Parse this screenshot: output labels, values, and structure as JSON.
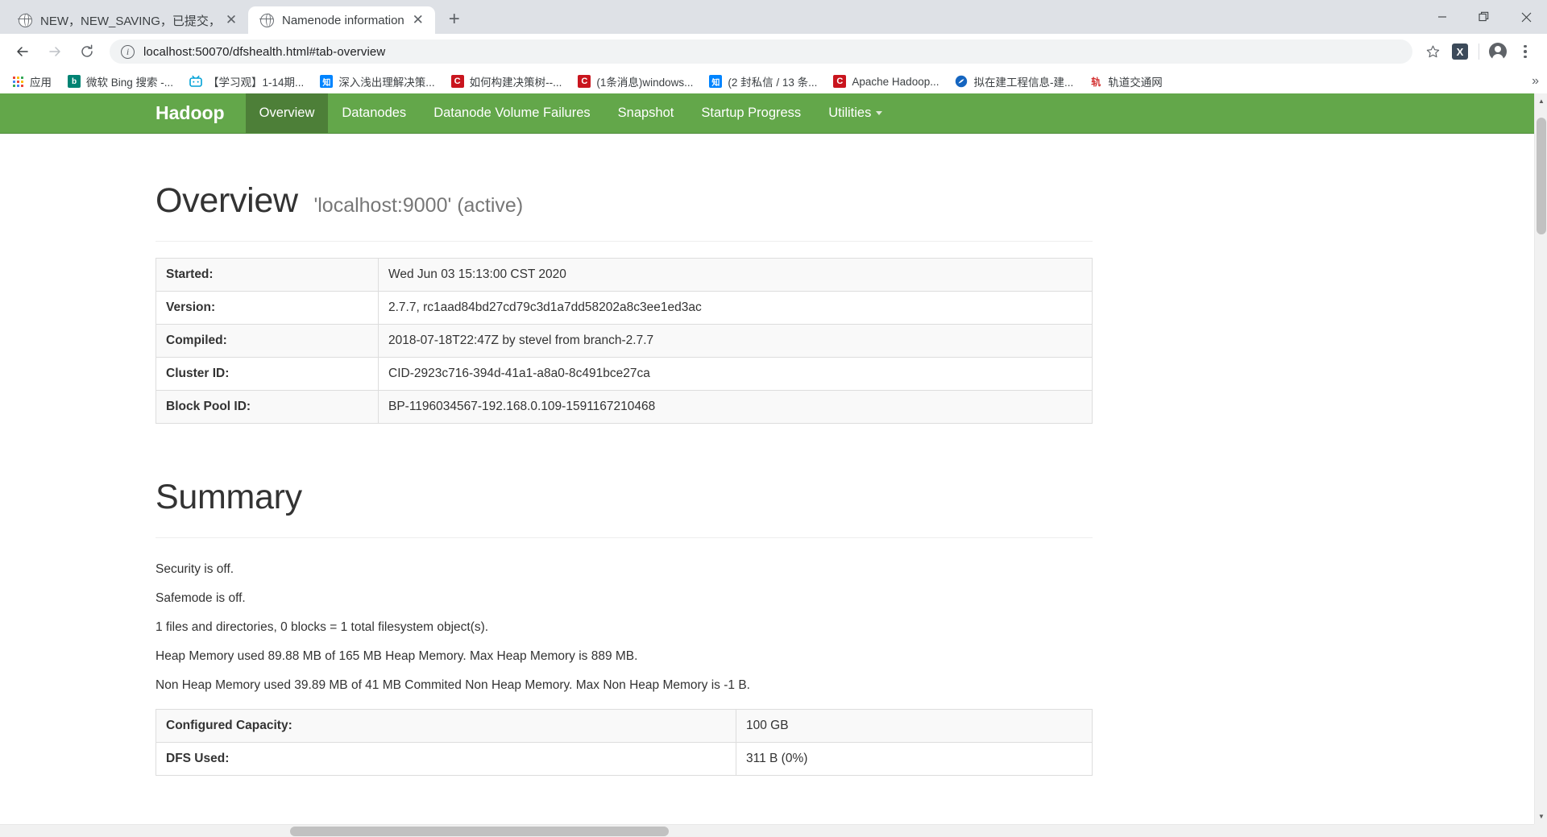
{
  "browser": {
    "tabs": [
      {
        "title": "NEW，NEW_SAVING，已提交，",
        "favicon": "globe-icon",
        "active": false
      },
      {
        "title": "Namenode information",
        "favicon": "globe-icon",
        "active": true
      }
    ],
    "newtab_label": "+",
    "window_controls": {
      "minimize": "minimize-icon",
      "maximize": "maximize-icon",
      "close": "close-icon"
    },
    "toolbar": {
      "back": "back-arrow-icon",
      "forward": "forward-arrow-icon",
      "reload": "reload-icon",
      "site_info": "info-icon",
      "url": "localhost:50070/dfshealth.html#tab-overview",
      "url_host": "localhost:50070",
      "url_path": "/dfshealth.html#tab-overview",
      "bookmark_star": "star-icon",
      "extension": "X",
      "profile": "avatar-icon",
      "menu": "kebab-menu-icon"
    },
    "bookmarks": [
      {
        "label": "应用",
        "icon": "apps-grid-icon",
        "color": "#5f6368"
      },
      {
        "label": "微软 Bing 搜索 -...",
        "icon": "bing-icon",
        "color": "#008373"
      },
      {
        "label": "【学习观】1-14期...",
        "icon": "bilibili-icon",
        "color": "#00A1D6"
      },
      {
        "label": "深入浅出理解决策...",
        "icon": "zhihu-icon",
        "color": "#0084FF"
      },
      {
        "label": "如何构建决策树--...",
        "icon": "csdn-icon",
        "color": "#C9151E"
      },
      {
        "label": "(1条消息)windows...",
        "icon": "csdn-icon",
        "color": "#C9151E"
      },
      {
        "label": "(2 封私信 / 13 条...",
        "icon": "zhihu-icon",
        "color": "#0084FF"
      },
      {
        "label": "Apache Hadoop...",
        "icon": "csdn-icon",
        "color": "#C9151E"
      },
      {
        "label": "拟在建工程信息-建...",
        "icon": "site-icon",
        "color": "#1565C0"
      },
      {
        "label": "轨道交通网",
        "icon": "rail-icon",
        "color": "#D32F2F"
      }
    ],
    "bookmarks_overflow": "»"
  },
  "hadoop": {
    "brand": "Hadoop",
    "nav": [
      {
        "label": "Overview",
        "active": true,
        "dropdown": false
      },
      {
        "label": "Datanodes",
        "active": false,
        "dropdown": false
      },
      {
        "label": "Datanode Volume Failures",
        "active": false,
        "dropdown": false
      },
      {
        "label": "Snapshot",
        "active": false,
        "dropdown": false
      },
      {
        "label": "Startup Progress",
        "active": false,
        "dropdown": false
      },
      {
        "label": "Utilities",
        "active": false,
        "dropdown": true
      }
    ],
    "navbar_color": "#63A74A",
    "navbar_active_color": "#4D7F38",
    "overview": {
      "title": "Overview",
      "subtitle": "'localhost:9000' (active)",
      "rows": [
        {
          "label": "Started:",
          "value": "Wed Jun 03 15:13:00 CST 2020"
        },
        {
          "label": "Version:",
          "value": "2.7.7, rc1aad84bd27cd79c3d1a7dd58202a8c3ee1ed3ac"
        },
        {
          "label": "Compiled:",
          "value": "2018-07-18T22:47Z by stevel from branch-2.7.7"
        },
        {
          "label": "Cluster ID:",
          "value": "CID-2923c716-394d-41a1-a8a0-8c491bce27ca"
        },
        {
          "label": "Block Pool ID:",
          "value": "BP-1196034567-192.168.0.109-1591167210468"
        }
      ]
    },
    "summary": {
      "title": "Summary",
      "lines": [
        "Security is off.",
        "Safemode is off.",
        "1 files and directories, 0 blocks = 1 total filesystem object(s).",
        "Heap Memory used 89.88 MB of 165 MB Heap Memory. Max Heap Memory is 889 MB.",
        "Non Heap Memory used 39.89 MB of 41 MB Commited Non Heap Memory. Max Non Heap Memory is -1 B."
      ],
      "rows": [
        {
          "label": "Configured Capacity:",
          "value": "100 GB"
        },
        {
          "label": "DFS Used:",
          "value": "311 B (0%)"
        }
      ]
    }
  }
}
